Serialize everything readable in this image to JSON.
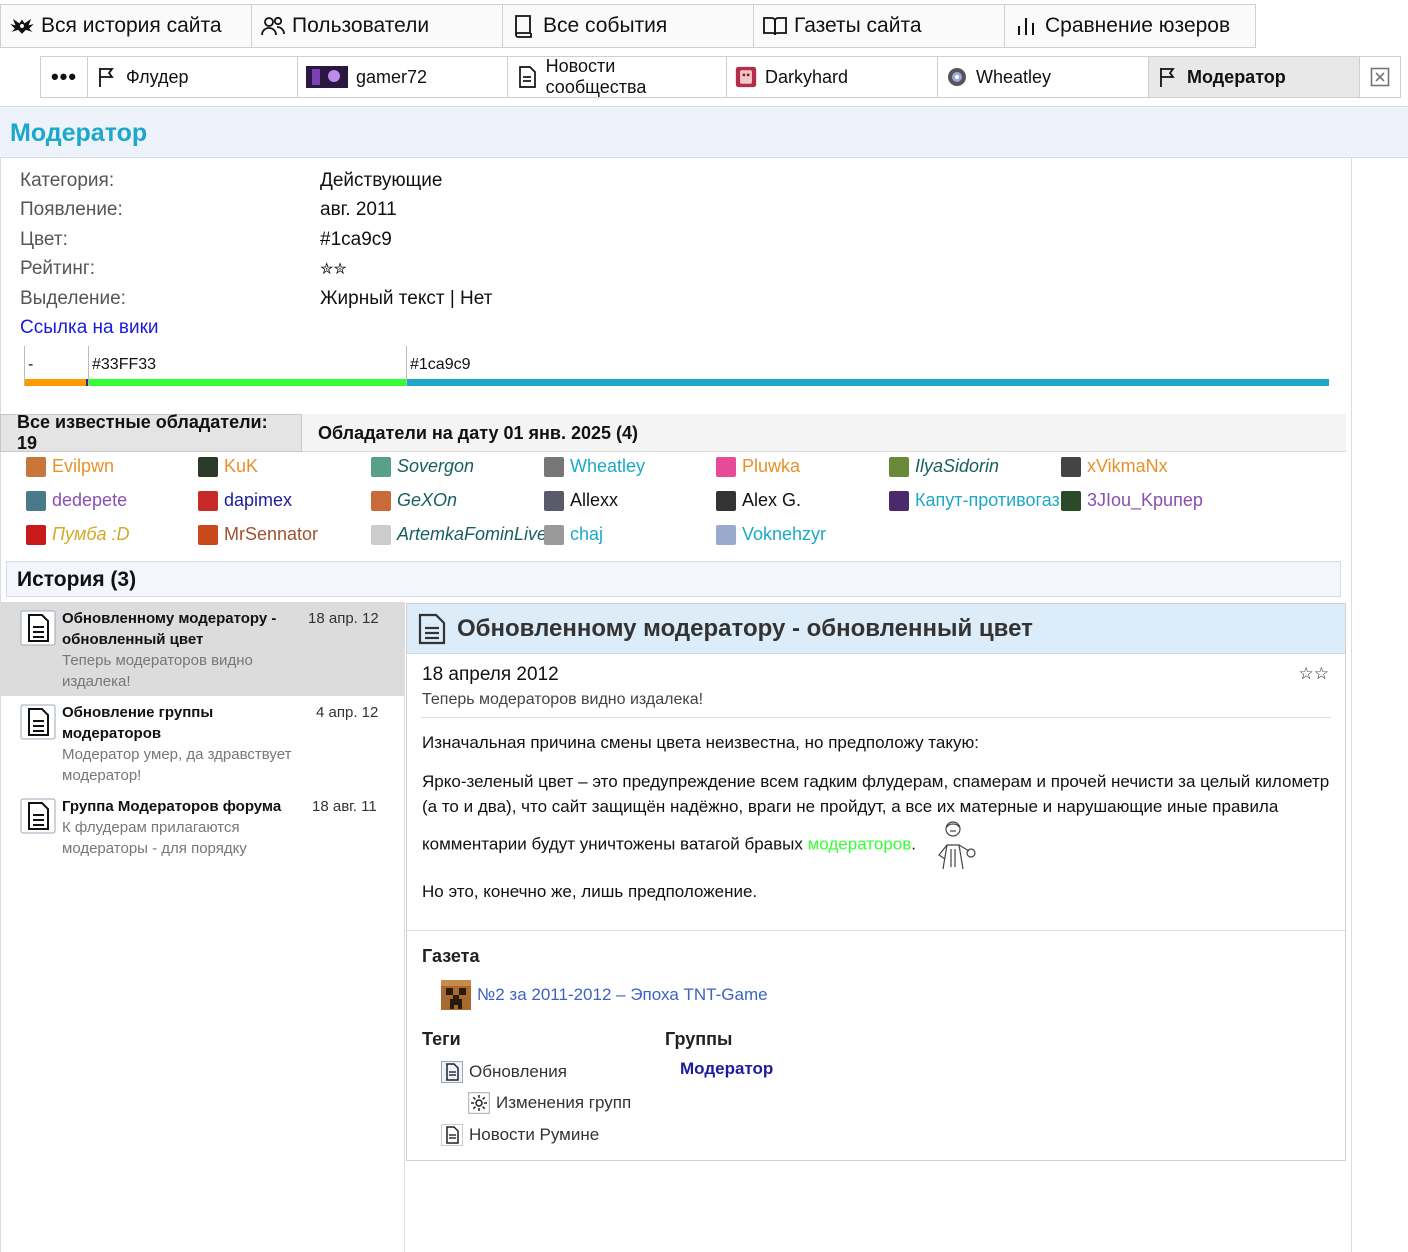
{
  "top_nav": [
    {
      "label": "Вся история сайта",
      "icon": "site-logo-icon"
    },
    {
      "label": "Пользователи",
      "icon": "users-icon"
    },
    {
      "label": "Все события",
      "icon": "book-icon"
    },
    {
      "label": "Газеты сайта",
      "icon": "open-book-icon"
    },
    {
      "label": "Сравнение юзеров",
      "icon": "bar-chart-icon"
    }
  ],
  "sub_tabs": [
    {
      "label": "Флудер",
      "icon": "flag-icon"
    },
    {
      "label": "gamer72",
      "icon": "avatar"
    },
    {
      "label": "Новости сообщества",
      "icon": "document-icon"
    },
    {
      "label": "Darkyhard",
      "icon": "avatar"
    },
    {
      "label": "Wheatley",
      "icon": "avatar"
    },
    {
      "label": "Модератор",
      "icon": "flag-icon"
    }
  ],
  "group": {
    "title": "Модератор",
    "color": "#1ca9c9",
    "props": [
      {
        "label": "Категория:",
        "value": "Действующие"
      },
      {
        "label": "Появление:",
        "value": "авг. 2011"
      },
      {
        "label": "Цвет:",
        "value": "#1ca9c9"
      },
      {
        "label": "Рейтинг:",
        "value": "✮✮"
      },
      {
        "label": "Выделение:",
        "value": "Жирный текст | Нет"
      }
    ],
    "wiki_link": "Ссылка на вики"
  },
  "color_history": [
    {
      "label": "-",
      "color": "#ff9900"
    },
    {
      "label": "#33FF33",
      "color": "#33ff33"
    },
    {
      "label": "#1ca9c9",
      "color": "#1ca9c9"
    }
  ],
  "owners_tabs": {
    "all": "Все известные обладатели: 19",
    "date": "Обладатели на дату 01 янв. 2025 (4)"
  },
  "owners": [
    {
      "name": "Evilpwn",
      "color": "#e8912a"
    },
    {
      "name": "KuK",
      "color": "#e8912a"
    },
    {
      "name": "Sovergon",
      "color": "#185f5f"
    },
    {
      "name": "Wheatley",
      "color": "#1ca9c9"
    },
    {
      "name": "Pluwka",
      "color": "#e8912a"
    },
    {
      "name": "IlyaSidorin",
      "color": "#185f5f"
    },
    {
      "name": "xVikmaNx",
      "color": "#e8912a"
    },
    {
      "name": "dedepete",
      "color": "#8a4fb0"
    },
    {
      "name": "dapimex",
      "color": "#1c1c9c"
    },
    {
      "name": "GeXOn",
      "color": "#185f5f"
    },
    {
      "name": "Allexx",
      "color": "#111111"
    },
    {
      "name": "Alex G.",
      "color": "#111111"
    },
    {
      "name": "Капут-противогаз",
      "color": "#1ca9c9"
    },
    {
      "name": "3JIou_Kpuпер",
      "color": "#8a4fb0"
    },
    {
      "name": "Пумба :D",
      "color": "#d4a82a"
    },
    {
      "name": "MrSennator",
      "color": "#a0522d"
    },
    {
      "name": "ArtemkaFominLive",
      "color": "#185f5f"
    },
    {
      "name": "chaj",
      "color": "#1ca9c9"
    },
    {
      "name": "Voknehzyr",
      "color": "#1ca9c9"
    }
  ],
  "history": {
    "title": "История (3)",
    "items": [
      {
        "title": "Обновленному модератору - обновленный цвет",
        "date": "18 апр. 12",
        "sub": "Теперь модераторов видно издалека!"
      },
      {
        "title": "Обновление группы модераторов",
        "date": "4 апр. 12",
        "sub": "Модератор умер, да здравствует модератор!"
      },
      {
        "title": "Группа Модераторов форума",
        "date": "18 авг. 11",
        "sub": "К флудерам прилагаются модераторы - для порядку"
      }
    ]
  },
  "detail": {
    "title": "Обновленному модератору - обновленный цвет",
    "date": "18 апреля 2012",
    "subtitle": "Теперь модераторов видно издалека!",
    "stars": "☆☆",
    "p1": "Изначальная причина смены цвета неизвестна, но предположу такую:",
    "p2_start": "Ярко-зеленый цвет – это предупреждение всем гадким флудерам, спамерам и прочей нечисти за целый километр (а то и два), что сайт защищён надёжно, враги не пройдут, а все их матерные и нарушающие иные правила комментарии будут уничтожены ватагой бравых ",
    "p2_link": "модераторов",
    "p2_end": ".",
    "p3": "Но это, конечно же, лишь предположение.",
    "newspaper_header": "Газета",
    "newspaper": "№2 за 2011-2012 – Эпоха TNT-Game",
    "tags_header": "Теги",
    "groups_header": "Группы",
    "tags": [
      "Обновления",
      "Изменения групп",
      "Новости Румине"
    ],
    "groups": [
      "Модератор"
    ]
  }
}
